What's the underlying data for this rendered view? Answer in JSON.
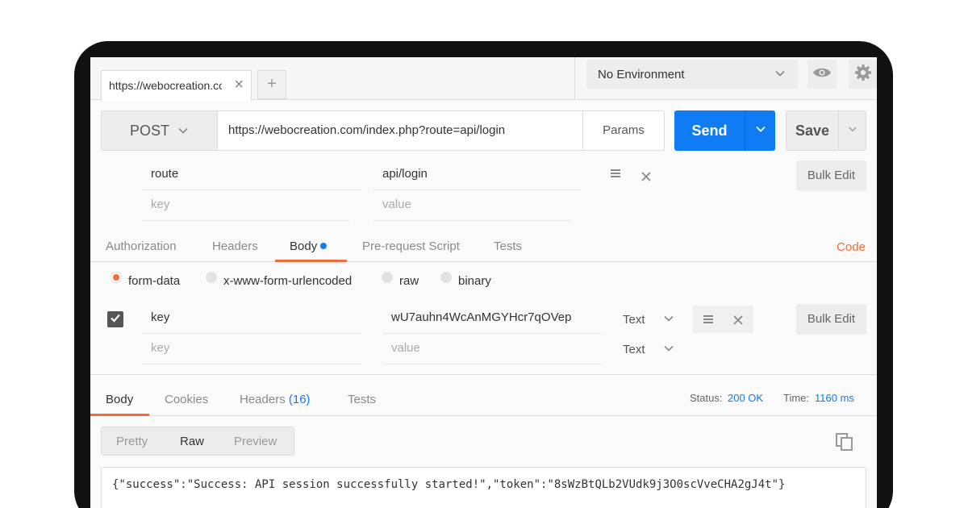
{
  "tabs": {
    "request_tab_label": "https://webocreation.com/index.php?route=api/login",
    "close_glyph": "×",
    "add_glyph": "+"
  },
  "environment": {
    "selected": "No Environment"
  },
  "request": {
    "method": "POST",
    "url": "https://webocreation.com/index.php?route=api/login",
    "params_label": "Params",
    "send_label": "Send",
    "save_label": "Save"
  },
  "params": {
    "rows": [
      {
        "key": "route",
        "value": "api/login"
      }
    ],
    "key_placeholder": "key",
    "value_placeholder": "value",
    "bulk_edit_label": "Bulk Edit"
  },
  "request_tabs": [
    "Authorization",
    "Headers",
    "Body",
    "Pre-request Script",
    "Tests"
  ],
  "code_label": "Code",
  "body_types": [
    "form-data",
    "x-www-form-urlencoded",
    "raw",
    "binary"
  ],
  "form_data": {
    "rows": [
      {
        "key": "key",
        "value": "wU7auhn4WcAnMGYHcr7qOVep",
        "type": "Text",
        "checked": true
      }
    ],
    "key_placeholder": "key",
    "value_placeholder": "value",
    "new_row_type": "Text",
    "bulk_edit_label": "Bulk Edit"
  },
  "response_tabs": {
    "body": "Body",
    "cookies": "Cookies",
    "headers": "Headers",
    "headers_count": "(16)",
    "tests": "Tests"
  },
  "status": {
    "status_label": "Status:",
    "status_value": "200 OK",
    "time_label": "Time:",
    "time_value": "1160 ms"
  },
  "view_modes": [
    "Pretty",
    "Raw",
    "Preview"
  ],
  "response_body": "{\"success\":\"Success: API session successfully started!\",\"token\":\"8sWzBtQLb2VUdk9j3O0scVveCHA2gJ4t\"}",
  "icons": [
    "close-icon",
    "plus-icon",
    "chevron-down-icon",
    "eye-icon",
    "gear-icon",
    "hamburger-icon",
    "checkmark-icon",
    "copy-icon"
  ],
  "colors": {
    "accent_blue": "#0f7cf4",
    "accent_orange": "#f26b3a",
    "device_frame": "#111111"
  }
}
